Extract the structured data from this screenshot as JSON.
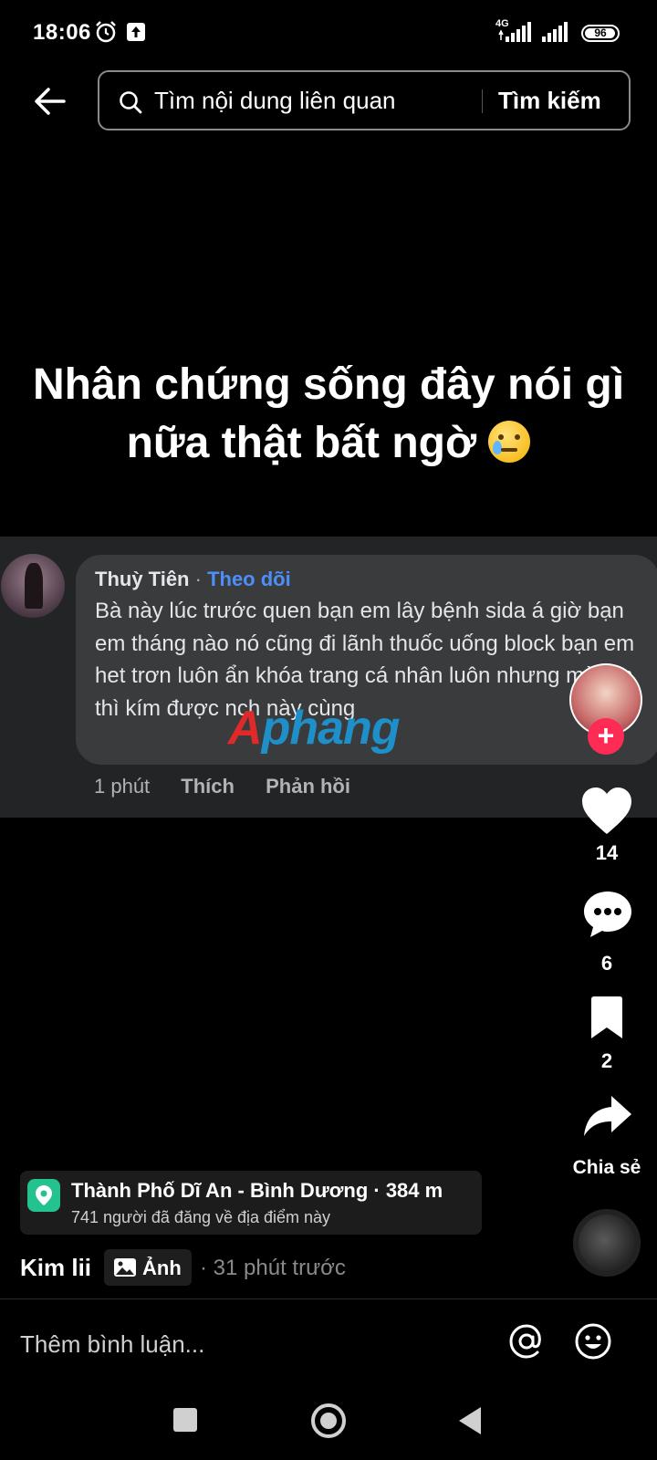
{
  "status_bar": {
    "time": "18:06",
    "network": "4G",
    "battery": "96",
    "battery_fraction": 0.96
  },
  "header": {
    "search_placeholder": "Tìm nội dung liên quan",
    "search_button": "Tìm kiếm"
  },
  "post": {
    "headline_line1": "Nhân chứng sống đây nói gì",
    "headline_line2": "nữa thật bất ngờ"
  },
  "comment": {
    "author": "Thuỳ Tiên",
    "separator": " · ",
    "follow_label": "Theo dõi",
    "text": "Bà này lúc trước quen bạn em lây bệnh sida á giờ bạn em tháng nào nó cũng đi lãnh thuốc uống block bạn em het trơn luôn ẩn khóa trang cá nhân luôn nhưng mà em thì kím được nch này cùng",
    "time": "1 phút",
    "like_label": "Thích",
    "reply_label": "Phản hồi"
  },
  "watermark": {
    "first": "A",
    "rest": "phang"
  },
  "actions": {
    "likes": "14",
    "comments": "6",
    "saves": "2",
    "share_label": "Chia sẻ"
  },
  "location": {
    "title": "Thành Phố Dĩ An - Bình Dương · 384 m",
    "subtitle": "741 người đã đăng về địa điểm này"
  },
  "author": {
    "name": "Kim lii",
    "badge": "Ảnh",
    "time": "· 31 phút trước"
  },
  "composer": {
    "placeholder": "Thêm bình luận..."
  },
  "colors": {
    "accent": "#fe2c55",
    "follow_link": "#4c8ff7",
    "location_pin": "#23c28e"
  }
}
